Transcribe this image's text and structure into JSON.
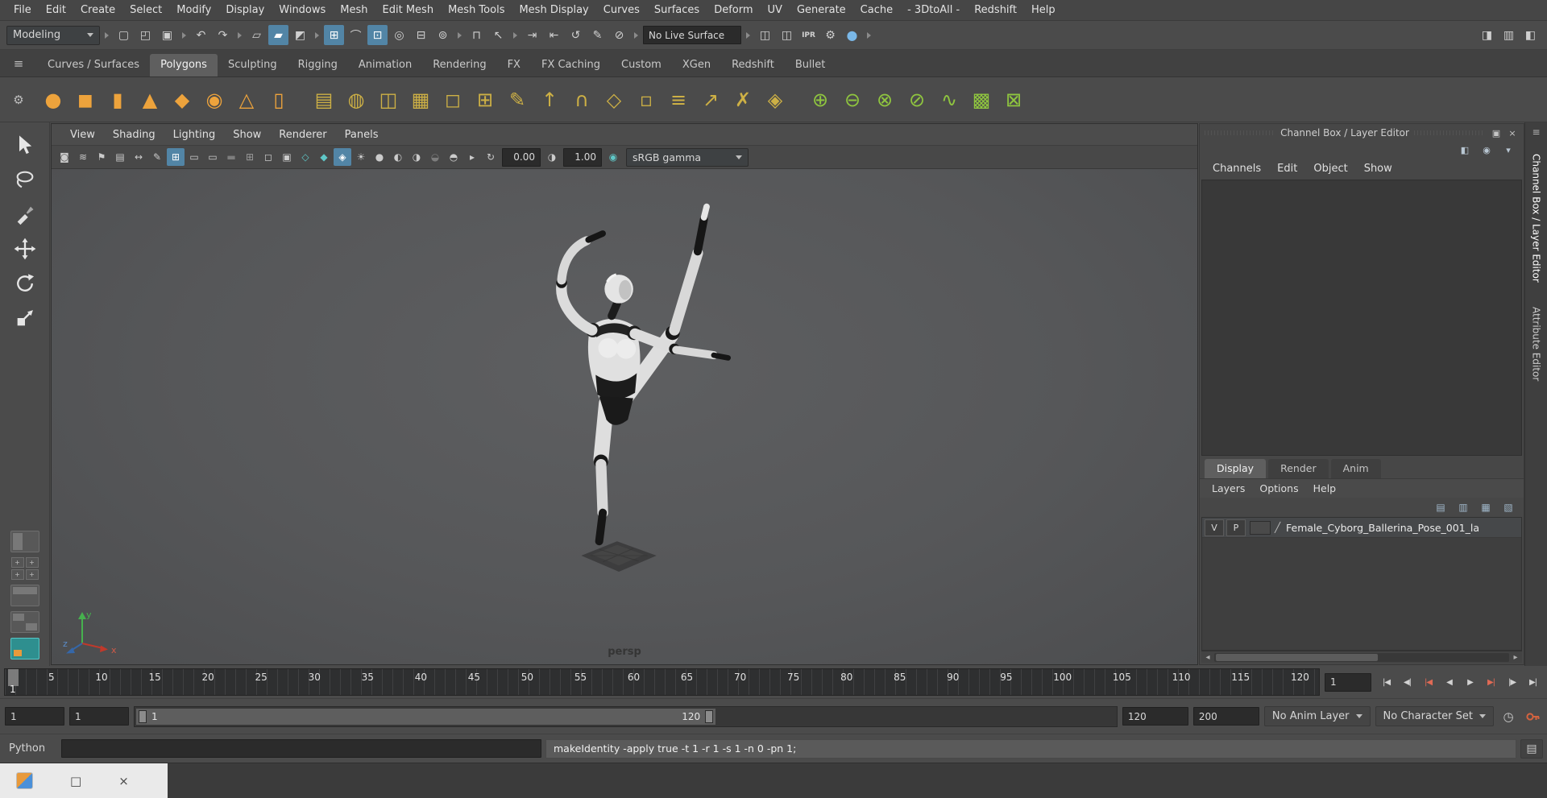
{
  "menubar": {
    "items": [
      "File",
      "Edit",
      "Create",
      "Select",
      "Modify",
      "Display",
      "Windows",
      "Mesh",
      "Edit Mesh",
      "Mesh Tools",
      "Mesh Display",
      "Curves",
      "Surfaces",
      "Deform",
      "UV",
      "Generate",
      "Cache",
      "- 3DtoAll -",
      "Redshift",
      "Help"
    ]
  },
  "statusline": {
    "menuset": "Modeling",
    "no_live_surface": "No Live Surface",
    "file_icons": [
      {
        "n": "new-scene-icon",
        "g": "▢"
      },
      {
        "n": "open-scene-icon",
        "g": "◰"
      },
      {
        "n": "save-scene-icon",
        "g": "▣"
      }
    ],
    "undo_icons": [
      {
        "n": "undo-icon",
        "g": "↶"
      },
      {
        "n": "redo-icon",
        "g": "↷"
      }
    ],
    "selection_icons": [
      {
        "n": "select-by-hierarchy-icon",
        "g": "▱"
      },
      {
        "n": "select-by-object-type-icon",
        "g": "▰",
        "cls": "active"
      },
      {
        "n": "select-by-component-type-icon",
        "g": "◩"
      }
    ],
    "snap_icons": [
      {
        "n": "snap-to-grid-icon",
        "g": "⊞",
        "cls": "active"
      },
      {
        "n": "snap-to-curves-icon",
        "g": "⌒"
      },
      {
        "n": "snap-to-points-icon",
        "g": "⊡",
        "cls": "active"
      },
      {
        "n": "snap-to-projected-center-icon",
        "g": "◎"
      },
      {
        "n": "snap-to-view-planes-icon",
        "g": "⊟"
      },
      {
        "n": "make-object-live-icon",
        "g": "⊚"
      }
    ],
    "lock_icons": [
      {
        "n": "lock-selection-icon",
        "g": "⊓"
      },
      {
        "n": "highlight-selection-mode-icon",
        "g": "↖"
      }
    ],
    "history_icons": [
      {
        "n": "input-connections-icon",
        "g": "⇥"
      },
      {
        "n": "output-connections-icon",
        "g": "⇤"
      },
      {
        "n": "construction-history-icon",
        "g": "↺"
      },
      {
        "n": "grease-pencil-scene-icon",
        "g": "✎"
      },
      {
        "n": "symmetry-off-icon",
        "g": "⊘"
      }
    ],
    "render_icons": [
      {
        "n": "render-current-frame-icon",
        "g": "◫"
      },
      {
        "n": "render-sequence-icon",
        "g": "◫"
      },
      {
        "n": "ipr-render-icon",
        "g": "IPR",
        "cls": "txt"
      },
      {
        "n": "render-settings-icon",
        "g": "⚙"
      },
      {
        "n": "hypershade-icon",
        "g": "●",
        "cls": "blue"
      }
    ],
    "view_toggle_icons": [
      {
        "n": "toggle-modeling-toolkit-icon",
        "g": "◨"
      },
      {
        "n": "toggle-tool-settings-icon",
        "g": "▥"
      },
      {
        "n": "toggle-attribute-editor-icon",
        "g": "◧"
      }
    ]
  },
  "shelf": {
    "menu_icon": "≡",
    "gear_icon": "⚙",
    "tabs": [
      {
        "label": "Curves / Surfaces"
      },
      {
        "label": "Polygons",
        "cls": "active"
      },
      {
        "label": "Sculpting"
      },
      {
        "label": "Rigging"
      },
      {
        "label": "Animation"
      },
      {
        "label": "Rendering"
      },
      {
        "label": "FX"
      },
      {
        "label": "FX Caching"
      },
      {
        "label": "Custom"
      },
      {
        "label": "XGen"
      },
      {
        "label": "Redshift"
      },
      {
        "label": "Bullet"
      }
    ],
    "icons": [
      {
        "n": "poly-sphere-icon",
        "g": "●",
        "c": "orange"
      },
      {
        "n": "poly-cube-icon",
        "g": "◼",
        "c": "orange"
      },
      {
        "n": "poly-cylinder-icon",
        "g": "▮",
        "c": "orange"
      },
      {
        "n": "poly-cone-icon",
        "g": "▲",
        "c": "orange"
      },
      {
        "n": "poly-plane-icon",
        "g": "◆",
        "c": "orange"
      },
      {
        "n": "poly-torus-icon",
        "g": "◉",
        "c": "orange"
      },
      {
        "n": "poly-pyramid-icon",
        "g": "△",
        "c": "orange"
      },
      {
        "n": "poly-pipe-icon",
        "g": "▯",
        "c": "orange"
      },
      {
        "n": "combine-icon",
        "g": "▤",
        "c": "tan",
        "gap": true
      },
      {
        "n": "smooth-icon",
        "g": "◍",
        "c": "tan"
      },
      {
        "n": "mirror-icon",
        "g": "◫",
        "c": "tan"
      },
      {
        "n": "subdivide-icon",
        "g": "▦",
        "c": "tan"
      },
      {
        "n": "smooth-preview-icon",
        "g": "◻",
        "c": "tan"
      },
      {
        "n": "add-divisions-icon",
        "g": "⊞",
        "c": "tan"
      },
      {
        "n": "multi-cut-icon",
        "g": "✎",
        "c": "tan"
      },
      {
        "n": "extrude-icon",
        "g": "↑",
        "c": "tan"
      },
      {
        "n": "bridge-icon",
        "g": "∩",
        "c": "tan"
      },
      {
        "n": "bevel-icon",
        "g": "◇",
        "c": "tan"
      },
      {
        "n": "circularize-icon",
        "g": "▫",
        "c": "tan"
      },
      {
        "n": "insert-edge-loop-icon",
        "g": "≡",
        "c": "tan"
      },
      {
        "n": "offset-edge-loop-icon",
        "g": "↗",
        "c": "tan"
      },
      {
        "n": "delete-edge-icon",
        "g": "✗",
        "c": "tan"
      },
      {
        "n": "separate-icon",
        "g": "◈",
        "c": "tan"
      },
      {
        "n": "boolean-union-icon",
        "g": "⊕",
        "c": "green",
        "gap": true
      },
      {
        "n": "boolean-difference-icon",
        "g": "⊖",
        "c": "green"
      },
      {
        "n": "boolean-intersection-icon",
        "g": "⊗",
        "c": "green"
      },
      {
        "n": "boolean-slice-icon",
        "g": "⊘",
        "c": "green"
      },
      {
        "n": "project-curve-icon",
        "g": "∿",
        "c": "green"
      },
      {
        "n": "quad-draw-icon",
        "g": "▩",
        "c": "green"
      },
      {
        "n": "remesh-icon",
        "g": "⊠",
        "c": "green"
      }
    ]
  },
  "viewport": {
    "panel_menus": [
      "View",
      "Shading",
      "Lighting",
      "Show",
      "Renderer",
      "Panels"
    ],
    "toolbar_icons": [
      {
        "n": "select-camera-icon",
        "g": "◙"
      },
      {
        "n": "camera-attributes-icon",
        "g": "≋"
      },
      {
        "n": "bookmarks-icon",
        "g": "⚑"
      },
      {
        "n": "image-plane-icon",
        "g": "▤"
      },
      {
        "n": "two-d-pan-zoom-icon",
        "g": "↔"
      },
      {
        "n": "grease-pencil-icon",
        "g": "✎"
      },
      {
        "n": "grid-toggle-icon",
        "g": "⊞",
        "cls": "on"
      },
      {
        "n": "film-gate-icon",
        "g": "▭"
      },
      {
        "n": "resolution-gate-icon",
        "g": "▭"
      },
      {
        "n": "gate-mask-icon",
        "g": "▬",
        "cls": "dim"
      },
      {
        "n": "field-chart-icon",
        "g": "⊞",
        "cls": "dim2"
      },
      {
        "n": "safe-action-icon",
        "g": "◻"
      },
      {
        "n": "safe-title-icon",
        "g": "▣"
      },
      {
        "n": "wireframe-mode-icon",
        "g": "◇",
        "cls": "teal"
      },
      {
        "n": "shaded-mode-icon",
        "g": "◆",
        "cls": "teal"
      },
      {
        "n": "textured-mode-icon",
        "g": "◈",
        "cls": "on"
      },
      {
        "n": "use-all-lights-icon",
        "g": "☀"
      },
      {
        "n": "shadows-icon",
        "g": "●"
      },
      {
        "n": "ambient-occlusion-icon",
        "g": "◐"
      },
      {
        "n": "motion-blur-icon",
        "g": "◑"
      },
      {
        "n": "multisample-icon",
        "g": "◒",
        "cls": "dim"
      },
      {
        "n": "xray-icon",
        "g": "◓"
      },
      {
        "n": "isolate-select-icon",
        "g": "▸"
      },
      {
        "n": "exposure-icon",
        "g": "↻"
      }
    ],
    "contrast_icon": "◑",
    "gamma_icon": "◉",
    "exposure": "0.00",
    "gamma": "1.00",
    "color_space": "sRGB gamma",
    "camera_label": "persp",
    "axis": [
      "x",
      "y",
      "z"
    ]
  },
  "channel_box": {
    "title": "Channel Box / Layer Editor",
    "title_icons": [
      {
        "n": "float-panel-icon",
        "g": "▣"
      },
      {
        "n": "close-panel-icon",
        "g": "×"
      }
    ],
    "corner_icons": [
      {
        "n": "channel-slider-mode-icon",
        "g": "◧"
      },
      {
        "n": "channel-speed-icon",
        "g": "◉"
      },
      {
        "n": "channel-options-icon",
        "g": "▾"
      }
    ],
    "menus": [
      "Channels",
      "Edit",
      "Object",
      "Show"
    ],
    "layer_editor": {
      "tabs": [
        {
          "label": "Display",
          "cls": "active"
        },
        {
          "label": "Render"
        },
        {
          "label": "Anim"
        }
      ],
      "menus": [
        "Layers",
        "Options",
        "Help"
      ],
      "toolbar_icons": [
        {
          "n": "move-selected-to-layer-icon",
          "g": "▤"
        },
        {
          "n": "empty-layer-icon",
          "g": "▥"
        },
        {
          "n": "new-layer-from-selected-icon",
          "g": "▦"
        },
        {
          "n": "layer-options-icon",
          "g": "▧"
        }
      ],
      "scroll_left": "◂",
      "scroll_right": "▸",
      "layers": [
        {
          "visible": "V",
          "playback": "P",
          "type_glyph": "╱",
          "name": "Female_Cyborg_Ballerina_Pose_001_la"
        }
      ]
    }
  },
  "right_tabs": {
    "menu_icon": "≡",
    "items": [
      {
        "label": "Channel Box / Layer Editor",
        "cls": "active"
      },
      {
        "label": "Attribute Editor"
      }
    ]
  },
  "timeline": {
    "current_frame": "1",
    "ticks": [
      "5",
      "10",
      "15",
      "20",
      "25",
      "30",
      "35",
      "40",
      "45",
      "50",
      "55",
      "60",
      "65",
      "70",
      "75",
      "80",
      "85",
      "90",
      "95",
      "100",
      "105",
      "110",
      "115",
      "120"
    ],
    "frame_field": "1",
    "playback": [
      {
        "n": "go-to-playback-start-button",
        "g": "|◀"
      },
      {
        "n": "step-back-frame-button",
        "g": "◀|"
      },
      {
        "n": "step-back-key-button",
        "g": "|◀",
        "cls": "red"
      },
      {
        "n": "play-backwards-button",
        "g": "◀"
      },
      {
        "n": "play-forwards-button",
        "g": "▶"
      },
      {
        "n": "step-forward-key-button",
        "g": "▶|",
        "cls": "red"
      },
      {
        "n": "step-forward-frame-button",
        "g": "|▶"
      },
      {
        "n": "go-to-playback-end-button",
        "g": "▶|"
      }
    ]
  },
  "range": {
    "anim_start": "1",
    "play_start": "1",
    "handle_start": "1",
    "handle_end": "120",
    "play_end": "120",
    "anim_end": "200",
    "anim_layer": "No Anim Layer",
    "character_set": "No Character Set",
    "prefs_icon": "◷"
  },
  "command_line": {
    "language": "Python",
    "input_value": "",
    "output": "makeIdentity -apply true -t 1 -r 1 -s 1 -n 0 -pn 1;",
    "script_editor_icon": "▤"
  },
  "taskbar": {
    "buttons": [
      {
        "n": "taskbar-app-icon",
        "g": "",
        "cls": "appicon"
      },
      {
        "n": "window-restore-button",
        "g": "□"
      },
      {
        "n": "window-close-button",
        "g": "×"
      }
    ]
  }
}
